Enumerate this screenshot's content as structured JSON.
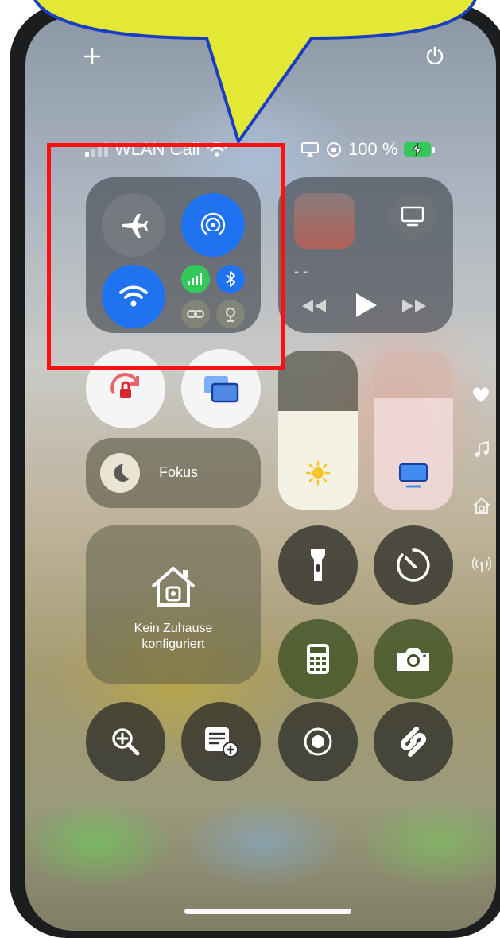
{
  "status_bar": {
    "carrier": "WLAN Call",
    "battery_percent": "100 %"
  },
  "connectivity": {
    "airplane": "off",
    "airdrop": "on",
    "wifi": "on",
    "cellular": "on",
    "bluetooth": "on"
  },
  "focus": {
    "label": "Fokus"
  },
  "home": {
    "line1": "Kein Zuhause",
    "line2": "konfiguriert"
  },
  "media": {
    "subtitle": "- -"
  },
  "brightness": {
    "level": 0.62
  },
  "volume": {
    "level": 0.7
  },
  "colors": {
    "accent_blue": "#1f73f0",
    "bluetooth_blue": "#1f73f0",
    "cellular_green": "#34c759",
    "highlight_red": "#ff1010",
    "callout_yellow": "#e3e834",
    "callout_border": "#1a3ec2"
  },
  "icons": [
    "plus-icon",
    "power-icon",
    "airplane-icon",
    "airdrop-icon",
    "wifi-icon",
    "cellular-icon",
    "bluetooth-icon",
    "link-icon",
    "satellite-icon",
    "screen-mirror-icon",
    "rotation-lock-icon",
    "moon-icon",
    "sun-icon",
    "tv-icon",
    "home-icon",
    "flashlight-icon",
    "timer-icon",
    "calculator-icon",
    "camera-icon",
    "magnifier-icon",
    "note-add-icon",
    "record-icon",
    "shazam-icon",
    "heart-icon",
    "music-icon",
    "signal-icon"
  ]
}
